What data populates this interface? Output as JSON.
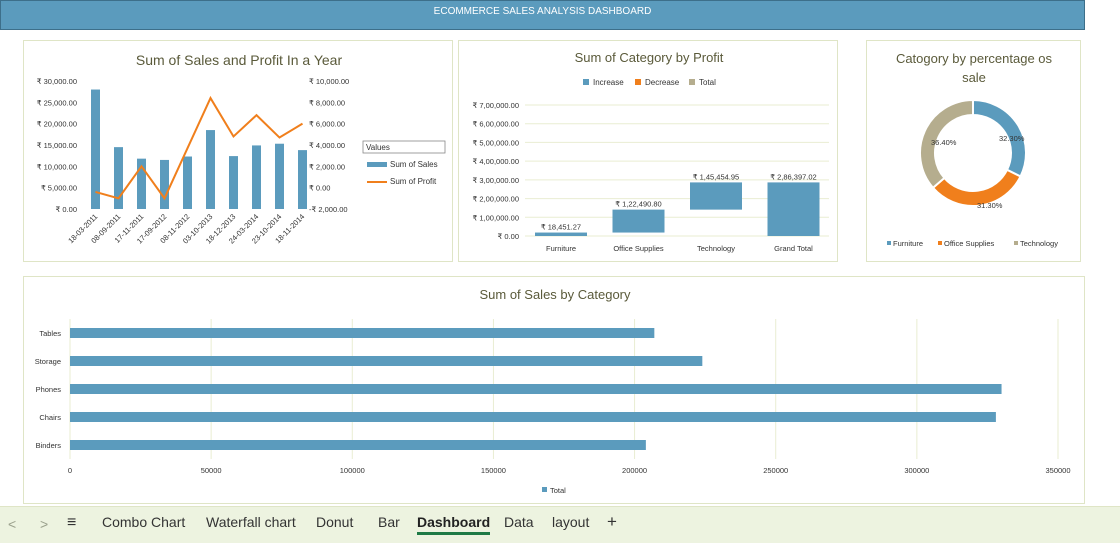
{
  "header": {
    "title": "ECOMMERCE SALES ANALYSIS  DASHBOARD"
  },
  "colors": {
    "sales": "#5b9bbd",
    "profit": "#f07f1c",
    "total": "#b5ad8e",
    "banner": "#5b9bbd"
  },
  "combo": {
    "chart_data": {
      "type": "bar",
      "title": "Sum of Sales and Profit In a Year",
      "categories": [
        "18-03-2011",
        "08-09-2011",
        "17-11-2011",
        "17-09-2012",
        "08-11-2012",
        "03-10-2013",
        "18-12-2013",
        "24-03-2014",
        "23-10-2014",
        "18-11-2014"
      ],
      "series": [
        {
          "name": "Sum of Sales",
          "axis": "left",
          "values": [
            28000,
            14500,
            11800,
            11500,
            12300,
            18500,
            12400,
            14900,
            15300,
            13800
          ]
        },
        {
          "name": "Sum of Profit",
          "axis": "right",
          "type": "line",
          "values": [
            -400,
            -1000,
            2000,
            -1000,
            3700,
            8400,
            4800,
            6800,
            4700,
            6000
          ]
        }
      ],
      "ylim_left": [
        0,
        30000
      ],
      "ylim_right": [
        -2000,
        10000
      ],
      "yticks_left": [
        "₹ 30,000.00",
        "₹ 25,000.00",
        "₹ 20,000.00",
        "₹ 15,000.00",
        "₹ 10,000.00",
        "₹ 5,000.00",
        "₹ 0.00"
      ],
      "yticks_right": [
        "₹ 10,000.00",
        "₹ 8,000.00",
        "₹ 6,000.00",
        "₹ 4,000.00",
        "₹ 2,000.00",
        "₹ 0.00",
        "-₹ 2,000.00"
      ],
      "legend_title": "Values"
    }
  },
  "waterfall": {
    "chart_data": {
      "type": "bar",
      "subtype": "waterfall",
      "title": "Sum of Category by Profit",
      "categories": [
        "Furniture",
        "Office Supplies",
        "Technology",
        "Grand Total"
      ],
      "values": [
        18451.27,
        122490.8,
        145454.95,
        286397.02
      ],
      "value_labels": [
        "₹ 18,451.27",
        "₹ 1,22,490.80",
        "₹ 1,45,454.95",
        "₹ 2,86,397.02"
      ],
      "ylim": [
        0,
        700000
      ],
      "yticks": [
        "₹ 7,00,000.00",
        "₹ 6,00,000.00",
        "₹ 5,00,000.00",
        "₹ 4,00,000.00",
        "₹ 3,00,000.00",
        "₹ 2,00,000.00",
        "₹ 1,00,000.00",
        "₹ 0.00"
      ],
      "legend": [
        "Increase",
        "Decrease",
        "Total"
      ]
    }
  },
  "donut": {
    "chart_data": {
      "type": "pie",
      "subtype": "donut",
      "title_line1": "Catogory by percentage os",
      "title_line2": "sale",
      "categories": [
        "Furniture",
        "Office Supplies",
        "Technology"
      ],
      "values": [
        32.3,
        31.3,
        36.4
      ],
      "labels": [
        "32.30%",
        "31.30%",
        "36.40%"
      ],
      "colors": [
        "#5b9bbd",
        "#f07f1c",
        "#b5ad8e"
      ]
    }
  },
  "hbar": {
    "chart_data": {
      "type": "bar",
      "orientation": "horizontal",
      "title": "Sum of Sales by Category",
      "categories": [
        "Tables",
        "Storage",
        "Phones",
        "Chairs",
        "Binders"
      ],
      "values": [
        207000,
        224000,
        330000,
        328000,
        204000
      ],
      "xlim": [
        0,
        350000
      ],
      "xticks": [
        "0",
        "50000",
        "100000",
        "150000",
        "200000",
        "250000",
        "300000",
        "350000"
      ],
      "legend": [
        "Total"
      ]
    }
  },
  "tabs": {
    "nav_prev": "<",
    "nav_next": ">",
    "menu": "≡",
    "items": [
      "Combo Chart",
      "Waterfall chart",
      "Donut",
      "Bar",
      "Dashboard",
      "Data",
      "layout"
    ],
    "add": "+"
  }
}
